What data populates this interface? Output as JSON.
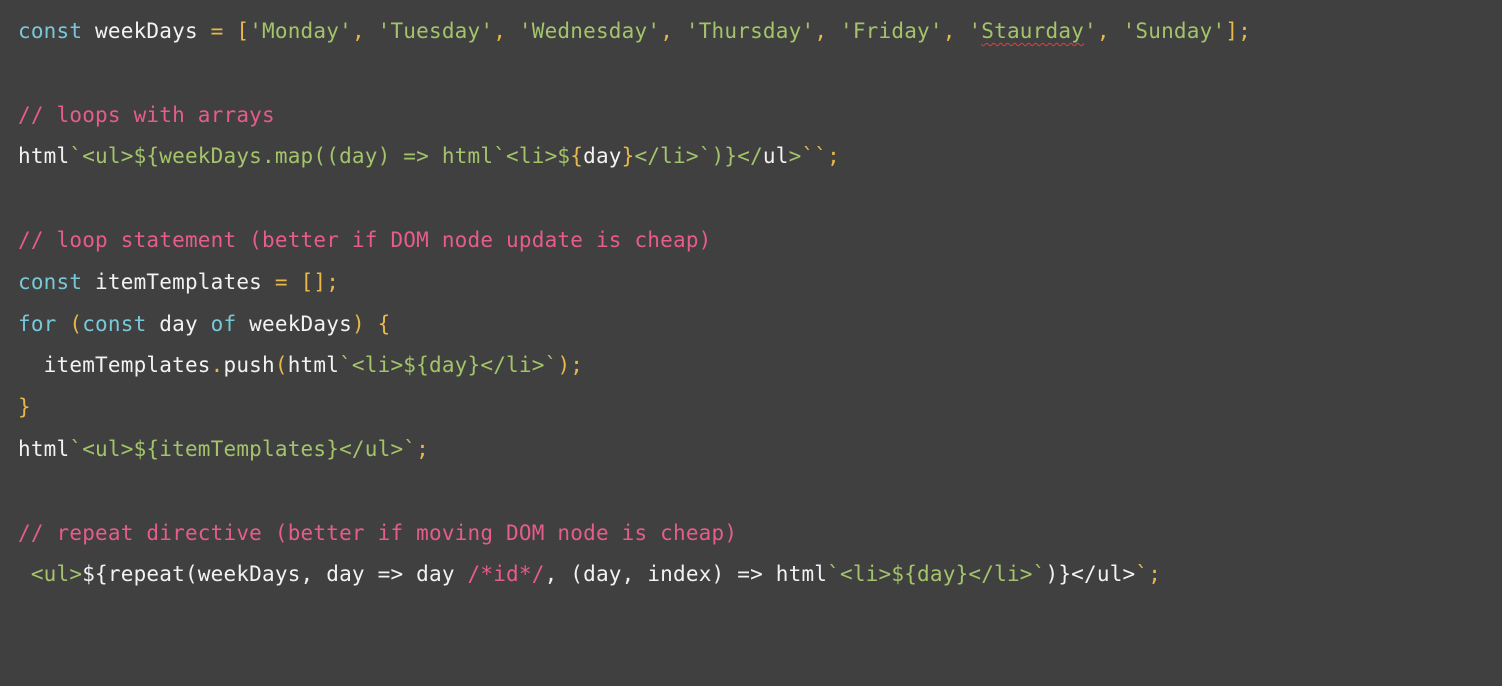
{
  "colors": {
    "background": "#404040",
    "keyword": "#78c8d8",
    "plain": "#f2f2f2",
    "operator": "#e8b84a",
    "string": "#a3c46a",
    "comment": "#e65c8a",
    "template": "#a3c46a"
  },
  "lines": [
    {
      "tokens": [
        {
          "t": "const",
          "c": "keyword"
        },
        {
          "t": " weekDays ",
          "c": "plain"
        },
        {
          "t": "=",
          "c": "operator"
        },
        {
          "t": " ",
          "c": "plain"
        },
        {
          "t": "[",
          "c": "operator"
        },
        {
          "t": "'Monday'",
          "c": "string"
        },
        {
          "t": ", ",
          "c": "operator"
        },
        {
          "t": "'Tuesday'",
          "c": "string"
        },
        {
          "t": ", ",
          "c": "operator"
        },
        {
          "t": "'Wednesday'",
          "c": "string"
        },
        {
          "t": ", ",
          "c": "operator"
        },
        {
          "t": "'Thursday'",
          "c": "string"
        },
        {
          "t": ", ",
          "c": "operator"
        },
        {
          "t": "'Friday'",
          "c": "string"
        },
        {
          "t": ", ",
          "c": "operator"
        },
        {
          "t": "'",
          "c": "string"
        },
        {
          "t": "Staurday",
          "c": "string",
          "misspelled": true
        },
        {
          "t": "'",
          "c": "string"
        },
        {
          "t": ", ",
          "c": "operator"
        },
        {
          "t": "'Sunday'",
          "c": "string"
        },
        {
          "t": "];",
          "c": "operator"
        }
      ]
    },
    {
      "tokens": []
    },
    {
      "tokens": [
        {
          "t": "// loops with arrays",
          "c": "comment"
        }
      ]
    },
    {
      "tokens": [
        {
          "t": "html",
          "c": "plain"
        },
        {
          "t": "`<ul>${weekDays.map((day) => html`<li>$",
          "c": "template"
        },
        {
          "t": "{",
          "c": "operator"
        },
        {
          "t": "day",
          "c": "plain"
        },
        {
          "t": "}",
          "c": "operator"
        },
        {
          "t": "</li>`)}</",
          "c": "template"
        },
        {
          "t": "ul",
          "c": "plain"
        },
        {
          "t": ">",
          "c": "template"
        },
        {
          "t": "``;",
          "c": "operator"
        }
      ]
    },
    {
      "tokens": []
    },
    {
      "tokens": [
        {
          "t": "// loop statement (better if DOM node update is cheap)",
          "c": "comment"
        }
      ]
    },
    {
      "tokens": [
        {
          "t": "const",
          "c": "keyword"
        },
        {
          "t": " itemTemplates ",
          "c": "plain"
        },
        {
          "t": "=",
          "c": "operator"
        },
        {
          "t": " ",
          "c": "plain"
        },
        {
          "t": "[];",
          "c": "operator"
        }
      ]
    },
    {
      "tokens": [
        {
          "t": "for",
          "c": "keyword"
        },
        {
          "t": " ",
          "c": "plain"
        },
        {
          "t": "(",
          "c": "operator"
        },
        {
          "t": "const",
          "c": "keyword"
        },
        {
          "t": " day ",
          "c": "plain"
        },
        {
          "t": "of",
          "c": "keyword"
        },
        {
          "t": " weekDays",
          "c": "plain"
        },
        {
          "t": ")",
          "c": "operator"
        },
        {
          "t": " ",
          "c": "plain"
        },
        {
          "t": "{",
          "c": "operator"
        }
      ]
    },
    {
      "tokens": [
        {
          "t": "  itemTemplates",
          "c": "plain"
        },
        {
          "t": ".",
          "c": "operator"
        },
        {
          "t": "push",
          "c": "plain"
        },
        {
          "t": "(",
          "c": "operator"
        },
        {
          "t": "html",
          "c": "plain"
        },
        {
          "t": "`<li>${day}</li>`",
          "c": "template"
        },
        {
          "t": ");",
          "c": "operator"
        }
      ]
    },
    {
      "tokens": [
        {
          "t": "}",
          "c": "operator"
        }
      ]
    },
    {
      "tokens": [
        {
          "t": "html",
          "c": "plain"
        },
        {
          "t": "`<ul>${itemTemplates}</ul>`",
          "c": "template"
        },
        {
          "t": ";",
          "c": "operator"
        }
      ]
    },
    {
      "tokens": []
    },
    {
      "tokens": [
        {
          "t": "// repeat directive (better if moving DOM node is cheap)",
          "c": "comment"
        }
      ]
    },
    {
      "tokens": [
        {
          "t": " ",
          "c": "plain"
        },
        {
          "t": "<ul>",
          "c": "template"
        },
        {
          "t": "${repeat(weekDays, day => day ",
          "c": "plain"
        },
        {
          "t": "/*id*/",
          "c": "comment"
        },
        {
          "t": ", (day, index) => html",
          "c": "plain"
        },
        {
          "t": "`<li>${day}</li>`",
          "c": "template"
        },
        {
          "t": ")}</ul>",
          "c": "plain"
        },
        {
          "t": "`;",
          "c": "operator"
        }
      ]
    }
  ]
}
